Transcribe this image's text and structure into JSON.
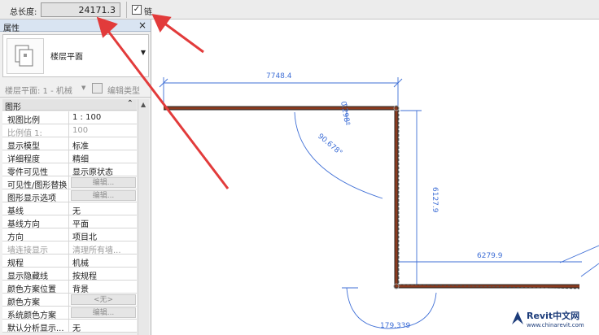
{
  "options_bar": {
    "total_length_label": "总长度:",
    "total_length_value": "24171.3",
    "chain_checked": true,
    "chain_label": "链"
  },
  "properties": {
    "title": "属性",
    "close": "×",
    "type_name": "楼层平面",
    "instance_selector": "楼层平面: 1 - 机械",
    "edit_type_label": "编辑类型",
    "group_label": "图形",
    "rows": [
      {
        "key": "视图比例",
        "value": "1 : 100"
      },
      {
        "key": "比例值 1:",
        "value": "100"
      },
      {
        "key": "显示模型",
        "value": "标准"
      },
      {
        "key": "详细程度",
        "value": "精细"
      },
      {
        "key": "零件可见性",
        "value": "显示原状态"
      },
      {
        "key": "可见性/图形替换",
        "value": "编辑..."
      },
      {
        "key": "图形显示选项",
        "value": "编辑..."
      },
      {
        "key": "基线",
        "value": "无"
      },
      {
        "key": "基线方向",
        "value": "平面"
      },
      {
        "key": "方向",
        "value": "项目北"
      },
      {
        "key": "墙连接显示",
        "value": "清理所有墙..."
      },
      {
        "key": "规程",
        "value": "机械"
      },
      {
        "key": "显示隐藏线",
        "value": "按规程"
      },
      {
        "key": "颜色方案位置",
        "value": "背景"
      },
      {
        "key": "颜色方案",
        "value": "<无>"
      },
      {
        "key": "系统颜色方案",
        "value": "编辑..."
      },
      {
        "key": "默认分析显示...",
        "value": "无"
      }
    ]
  },
  "drawing": {
    "dim_top": "7748.4",
    "dim_small": "0.298°",
    "dim_angle1": "90.678°",
    "dim_right": "6127.9",
    "dim_bottom": "6279.9",
    "dim_angle2": "179.339",
    "wall_color": "#8b3a1e",
    "dim_color": "#3f6fd6",
    "arrow_color": "#e23b3b"
  },
  "watermark": {
    "brand": "Revit中文网",
    "url": "www.chinarevit.com"
  }
}
